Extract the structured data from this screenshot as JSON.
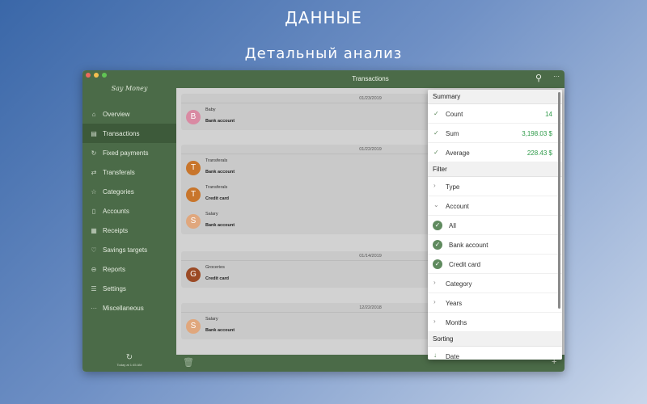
{
  "banner": {
    "title": "ДАННЫЕ",
    "subtitle": "Детальный анализ"
  },
  "app": {
    "logo_text": "Say Money",
    "window_title": "Transactions"
  },
  "sidebar": {
    "items": [
      {
        "label": "Overview",
        "icon": "home-icon"
      },
      {
        "label": "Transactions",
        "icon": "list-icon",
        "active": true
      },
      {
        "label": "Fixed payments",
        "icon": "repeat-icon"
      },
      {
        "label": "Transferals",
        "icon": "shuffle-icon"
      },
      {
        "label": "Categories",
        "icon": "star-icon"
      },
      {
        "label": "Accounts",
        "icon": "book-icon"
      },
      {
        "label": "Receipts",
        "icon": "receipt-icon"
      },
      {
        "label": "Savings targets",
        "icon": "heart-icon"
      },
      {
        "label": "Reports",
        "icon": "chart-icon"
      },
      {
        "label": "Settings",
        "icon": "sliders-icon"
      },
      {
        "label": "Miscellaneous",
        "icon": "ellipsis-icon"
      }
    ],
    "sync_text": "Today at 1:45 AM"
  },
  "groups": [
    {
      "date": "01/23/2019",
      "items": [
        {
          "letter": "B",
          "category": "Baby",
          "account": "Bank account",
          "color": "#d98aa3"
        }
      ]
    },
    {
      "date": "01/22/2019",
      "items": [
        {
          "letter": "T",
          "category": "Transferals",
          "account": "Bank account",
          "color": "#c8752b"
        },
        {
          "letter": "T",
          "category": "Transferals",
          "account": "Credit card",
          "color": "#c8752b"
        },
        {
          "letter": "S",
          "category": "Salary",
          "account": "Bank account",
          "color": "#e0a77d"
        }
      ]
    },
    {
      "date": "01/14/2019",
      "items": [
        {
          "letter": "G",
          "category": "Groceries",
          "account": "Credit card",
          "color": "#9b4a25"
        }
      ]
    },
    {
      "date": "12/22/2018",
      "items": [
        {
          "letter": "S",
          "category": "Salary",
          "account": "Bank account",
          "color": "#e0a77d"
        }
      ]
    }
  ],
  "popover": {
    "summary_header": "Summary",
    "summary": [
      {
        "label": "Count",
        "value": "14"
      },
      {
        "label": "Sum",
        "value": "3,198.03 $"
      },
      {
        "label": "Average",
        "value": "228.43 $"
      }
    ],
    "filter_header": "Filter",
    "type_label": "Type",
    "account_label": "Account",
    "account_options": [
      "All",
      "Bank account",
      "Credit card"
    ],
    "category_label": "Category",
    "years_label": "Years",
    "months_label": "Months",
    "sorting_header": "Sorting",
    "sort_label": "Date"
  },
  "colors": {
    "sidebar_green": "#4b6b48",
    "accent_green": "#5f8a5e",
    "value_green": "#2e9a49"
  }
}
